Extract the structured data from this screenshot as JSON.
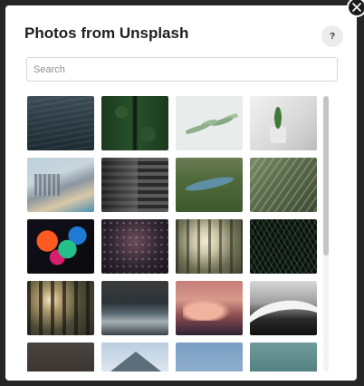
{
  "dialog": {
    "title": "Photos from Unsplash",
    "help_label": "?",
    "close_icon": "close-icon"
  },
  "search": {
    "placeholder": "Search",
    "value": ""
  },
  "photos": [
    {
      "name": "photo-ocean-water",
      "style": "p-ocean"
    },
    {
      "name": "photo-forest-road-aerial",
      "style": "p-forest-road"
    },
    {
      "name": "photo-leaf-branch",
      "style": "p-leaf"
    },
    {
      "name": "photo-plant-vase",
      "style": "p-plant"
    },
    {
      "name": "photo-city-beach",
      "style": "p-city"
    },
    {
      "name": "photo-building-facade",
      "style": "p-building"
    },
    {
      "name": "photo-river-landscape",
      "style": "p-river"
    },
    {
      "name": "photo-palm-leaves",
      "style": "p-palm"
    },
    {
      "name": "photo-abstract-paint",
      "style": "p-abstract"
    },
    {
      "name": "photo-raindrops",
      "style": "p-rain"
    },
    {
      "name": "photo-sunlit-forest",
      "style": "p-sunforest"
    },
    {
      "name": "photo-pine-branches",
      "style": "p-pine"
    },
    {
      "name": "photo-forest-sunrays",
      "style": "p-trees"
    },
    {
      "name": "photo-rocky-coast",
      "style": "p-coast"
    },
    {
      "name": "photo-pink-clouds",
      "style": "p-cloud"
    },
    {
      "name": "photo-curved-architecture",
      "style": "p-curve"
    },
    {
      "name": "photo-dark-rocks",
      "style": "p-dark-rocks"
    },
    {
      "name": "photo-snowy-mountain",
      "style": "p-mountain"
    },
    {
      "name": "photo-blue-sky",
      "style": "p-sky"
    },
    {
      "name": "photo-teal-landscape",
      "style": "p-teal"
    }
  ],
  "scroll": {
    "position_fraction": 0.0,
    "visible_fraction": 0.58
  }
}
